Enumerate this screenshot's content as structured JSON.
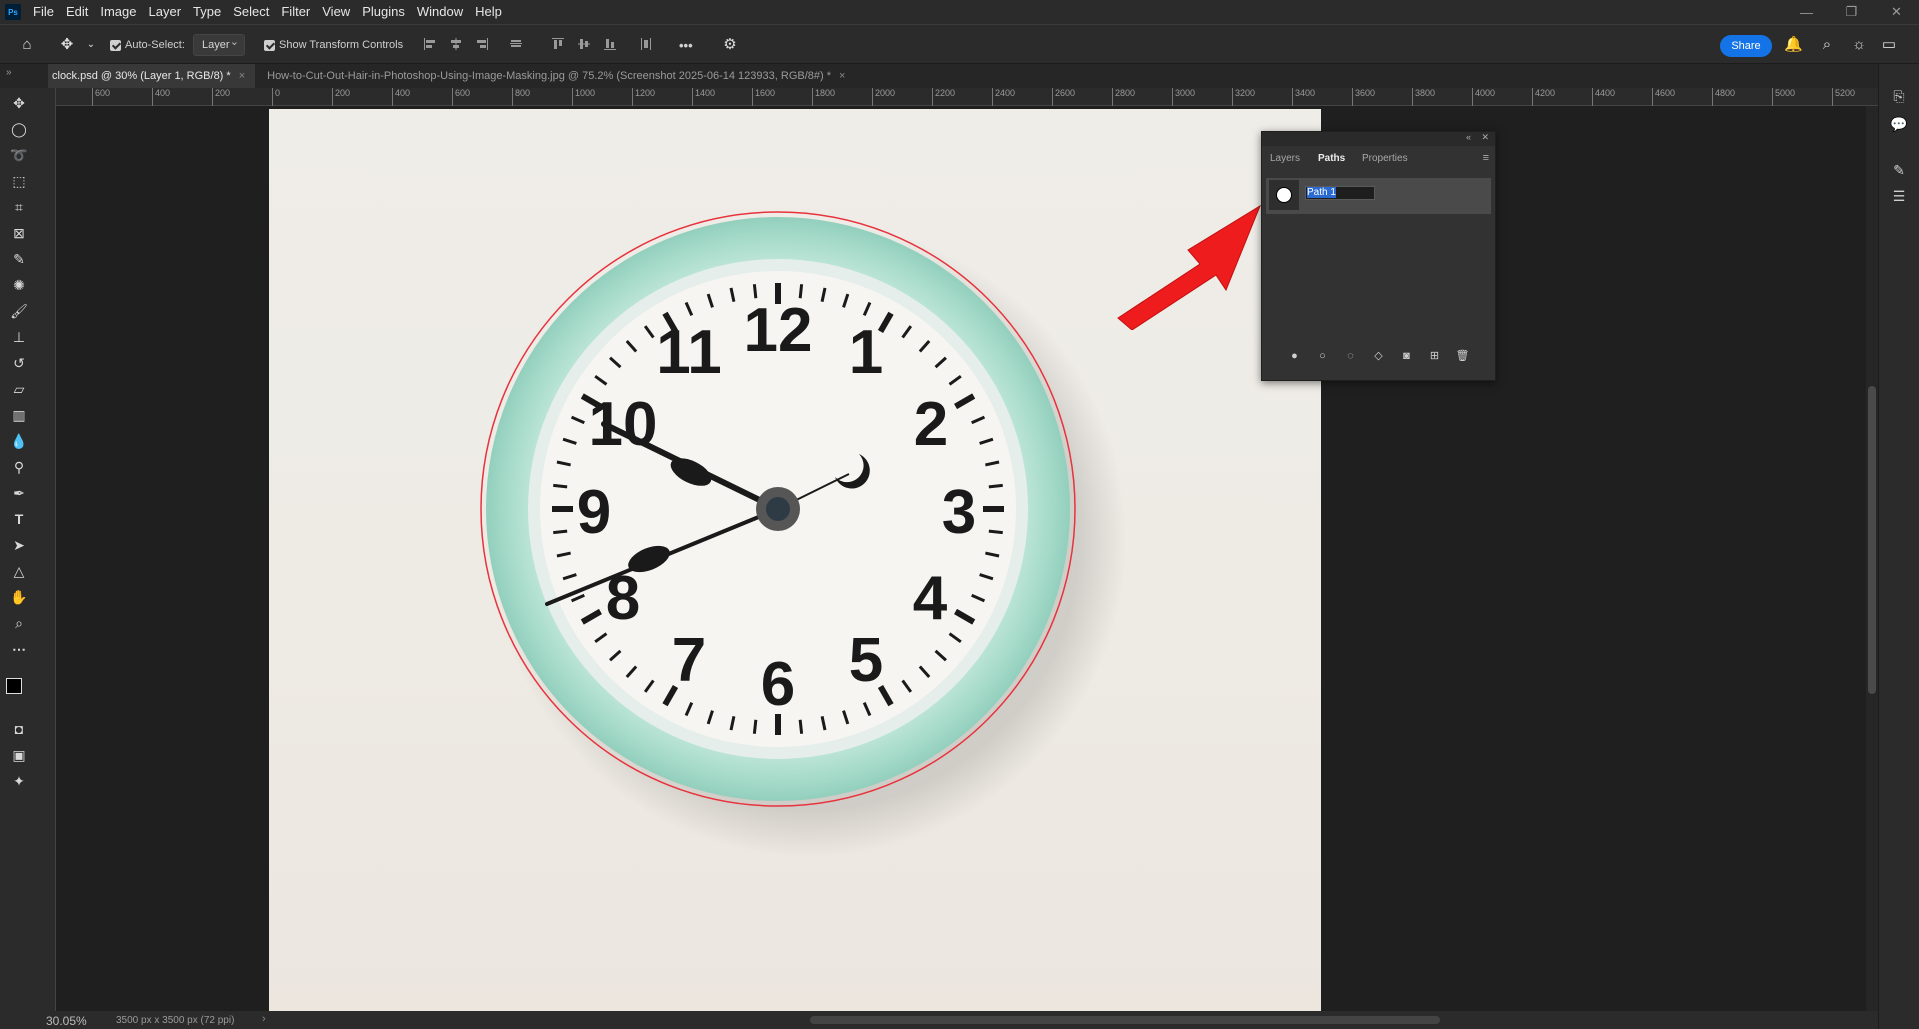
{
  "app": {
    "logo": "Ps"
  },
  "menu": [
    "File",
    "Edit",
    "Image",
    "Layer",
    "Type",
    "Select",
    "Filter",
    "View",
    "Plugins",
    "Window",
    "Help"
  ],
  "options": {
    "auto_select_label": "Auto-Select:",
    "auto_select_value": "Layer",
    "show_transform_label": "Show Transform Controls",
    "more_label": "•••",
    "share_label": "Share"
  },
  "tabs": [
    {
      "label": "clock.psd @ 30% (Layer 1, RGB/8) *",
      "active": true
    },
    {
      "label": "How-to-Cut-Out-Hair-in-Photoshop-Using-Image-Masking.jpg @ 75.2% (Screenshot 2025-06-14 123933, RGB/8#) *",
      "active": false
    }
  ],
  "ruler_top": [
    "600",
    "400",
    "200",
    "0",
    "200",
    "400",
    "600",
    "800",
    "1000",
    "1200",
    "1400",
    "1600",
    "1800",
    "2000",
    "2200",
    "2400",
    "2600",
    "2800",
    "3000",
    "3200",
    "3400",
    "3600",
    "3800",
    "4000",
    "4200",
    "4400",
    "4600",
    "4800",
    "5000",
    "5200"
  ],
  "paths_panel": {
    "tabs": [
      "Layers",
      "Paths",
      "Properties"
    ],
    "active_tab": "Paths",
    "path_name": "Path 1"
  },
  "clock_numerals": [
    "12",
    "1",
    "2",
    "3",
    "4",
    "5",
    "6",
    "7",
    "8",
    "9",
    "10",
    "11"
  ],
  "status": {
    "zoom": "30.05%",
    "doc_size": "3500 px x 3500 px (72 ppi)"
  },
  "colors": {
    "accent": "#1473e6",
    "selection_path": "#e8323c",
    "annotation_arrow": "#ee1c1c",
    "clock_rim": "#a9dccb"
  }
}
